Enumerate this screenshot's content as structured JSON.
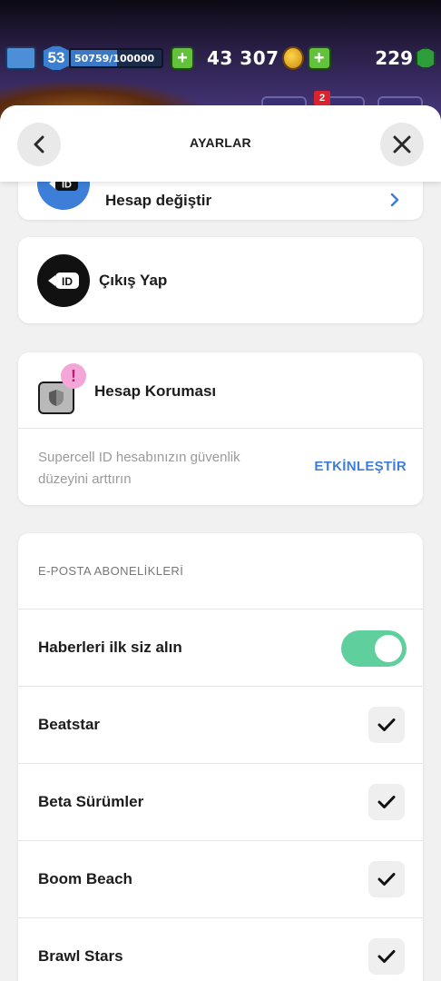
{
  "hud": {
    "level": "53",
    "xp": "50759/100000",
    "xp_fraction": 0.5076,
    "gold": "43 307",
    "gems": "229",
    "notification_count": "2"
  },
  "header": {
    "title": "AYARLAR",
    "back_icon": "chevron-left-icon",
    "close_icon": "close-icon"
  },
  "account": {
    "switch_label": "Hesap değiştir",
    "logout_label": "Çıkış Yap",
    "id_badge": "ID"
  },
  "protection": {
    "title": "Hesap Koruması",
    "alert": "!",
    "description": "Supercell ID hesabınızın güvenlik düzeyini arttırın",
    "action": "ETKİNLEŞTİR"
  },
  "subscriptions": {
    "title": "E-POSTA ABONELİKLERİ",
    "news_label": "Haberleri ilk siz alın",
    "news_enabled": true,
    "items": [
      {
        "label": "Beatstar",
        "checked": true
      },
      {
        "label": "Beta Sürümler",
        "checked": true
      },
      {
        "label": "Boom Beach",
        "checked": true
      },
      {
        "label": "Brawl Stars",
        "checked": true
      }
    ]
  },
  "colors": {
    "accent_blue": "#3d7fd8",
    "toggle_green": "#5fcf9e",
    "alert_pink": "#f4a6d8"
  }
}
